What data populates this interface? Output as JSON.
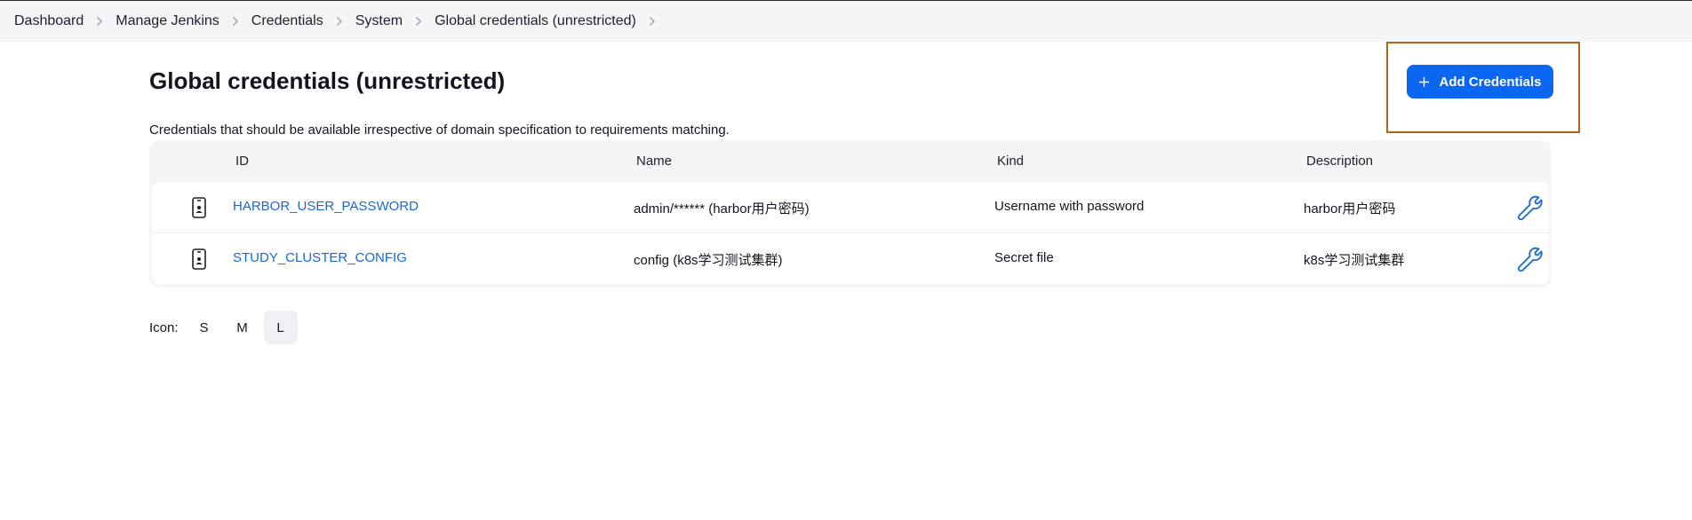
{
  "breadcrumb": [
    "Dashboard",
    "Manage Jenkins",
    "Credentials",
    "System",
    "Global credentials (unrestricted)"
  ],
  "page": {
    "title": "Global credentials (unrestricted)",
    "description": "Credentials that should be available irrespective of domain specification to requirements matching.",
    "add_button_label": "Add Credentials"
  },
  "table": {
    "headers": {
      "id": "ID",
      "name": "Name",
      "kind": "Kind",
      "description": "Description"
    },
    "rows": [
      {
        "icon": "mobile-device-icon",
        "id": "HARBOR_USER_PASSWORD",
        "name": "admin/****** (harbor用户密码)",
        "kind": "Username with password",
        "description": "harbor用户密码",
        "action_icon": "wrench-icon"
      },
      {
        "icon": "mobile-device-icon",
        "id": "STUDY_CLUSTER_CONFIG",
        "name": "config (k8s学习测试集群)",
        "kind": "Secret file",
        "description": "k8s学习测试集群",
        "action_icon": "wrench-icon"
      }
    ]
  },
  "icon_size": {
    "label": "Icon:",
    "options": [
      "S",
      "M",
      "L"
    ],
    "selected": "L"
  },
  "colors": {
    "accent": "#0b66f2",
    "link": "#1a68d6",
    "highlight": "#b4641a"
  }
}
